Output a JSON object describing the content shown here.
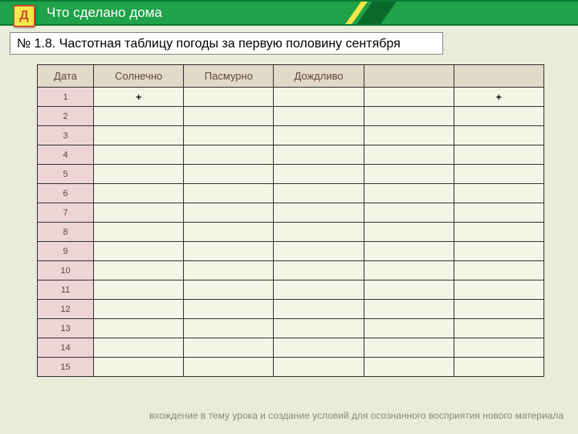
{
  "badge": {
    "letter": "Д"
  },
  "header": {
    "title": "Что сделано дома"
  },
  "task": {
    "text": "№ 1.8.  Частотная  таблицу погоды за первую половину сентября"
  },
  "table": {
    "headers": [
      "Дата",
      "Солнечно",
      "Пасмурно",
      "Дождливо",
      "",
      ""
    ],
    "rows": [
      {
        "date": "1",
        "marks": [
          "+",
          "",
          "",
          "",
          "+"
        ]
      },
      {
        "date": "2",
        "marks": [
          "",
          "",
          "",
          "",
          ""
        ]
      },
      {
        "date": "3",
        "marks": [
          "",
          "",
          "",
          "",
          ""
        ]
      },
      {
        "date": "4",
        "marks": [
          "",
          "",
          "",
          "",
          ""
        ]
      },
      {
        "date": "5",
        "marks": [
          "",
          "",
          "",
          "",
          ""
        ]
      },
      {
        "date": "6",
        "marks": [
          "",
          "",
          "",
          "",
          ""
        ]
      },
      {
        "date": "7",
        "marks": [
          "",
          "",
          "",
          "",
          ""
        ]
      },
      {
        "date": "8",
        "marks": [
          "",
          "",
          "",
          "",
          ""
        ]
      },
      {
        "date": "9",
        "marks": [
          "",
          "",
          "",
          "",
          ""
        ]
      },
      {
        "date": "10",
        "marks": [
          "",
          "",
          "",
          "",
          ""
        ]
      },
      {
        "date": "11",
        "marks": [
          "",
          "",
          "",
          "",
          ""
        ]
      },
      {
        "date": "12",
        "marks": [
          "",
          "",
          "",
          "",
          ""
        ]
      },
      {
        "date": "13",
        "marks": [
          "",
          "",
          "",
          "",
          ""
        ]
      },
      {
        "date": "14",
        "marks": [
          "",
          "",
          "",
          "",
          ""
        ]
      },
      {
        "date": "15",
        "marks": [
          "",
          "",
          "",
          "",
          ""
        ]
      }
    ]
  },
  "footer": {
    "text": "вхождение в тему урока и создание условий для осознанного восприятия нового материала"
  }
}
